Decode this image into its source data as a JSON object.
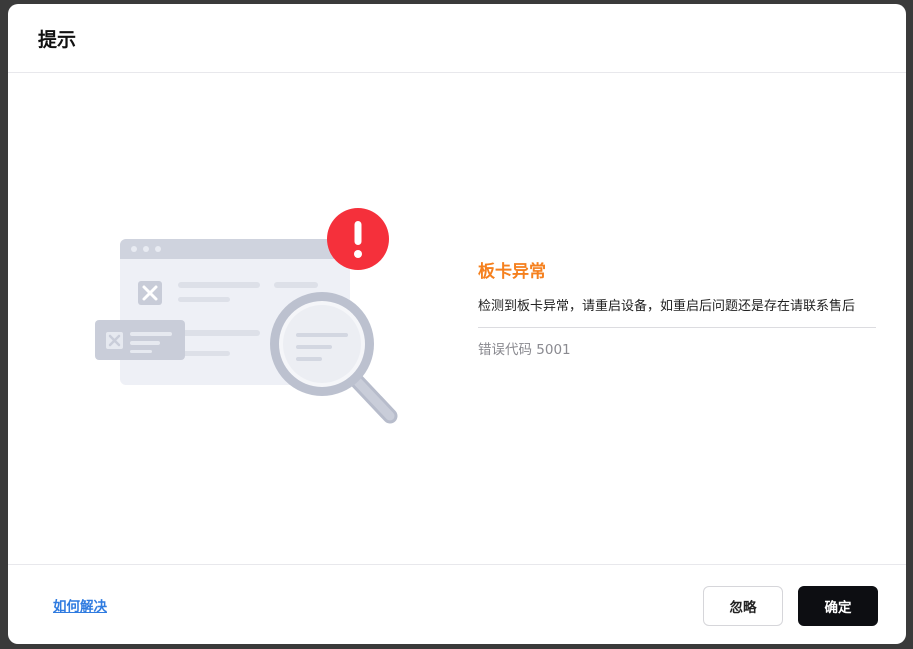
{
  "dialog": {
    "title": "提示"
  },
  "error": {
    "title": "板卡异常",
    "description": "检测到板卡异常，请重启设备，如重启后问题还是存在请联系售后",
    "code_text": "错误代码 5001"
  },
  "footer": {
    "help_link": "如何解决",
    "ignore_label": "忽略",
    "confirm_label": "确定"
  },
  "illustration": {
    "icons": [
      "browser-window-icon",
      "error-card-icon",
      "magnifier-icon",
      "alert-badge-icon"
    ],
    "alert_color": "#f5303b"
  },
  "colors": {
    "accent_orange": "#f5801e",
    "link_blue": "#2f7be0",
    "confirm_bg": "#0d0e12"
  }
}
